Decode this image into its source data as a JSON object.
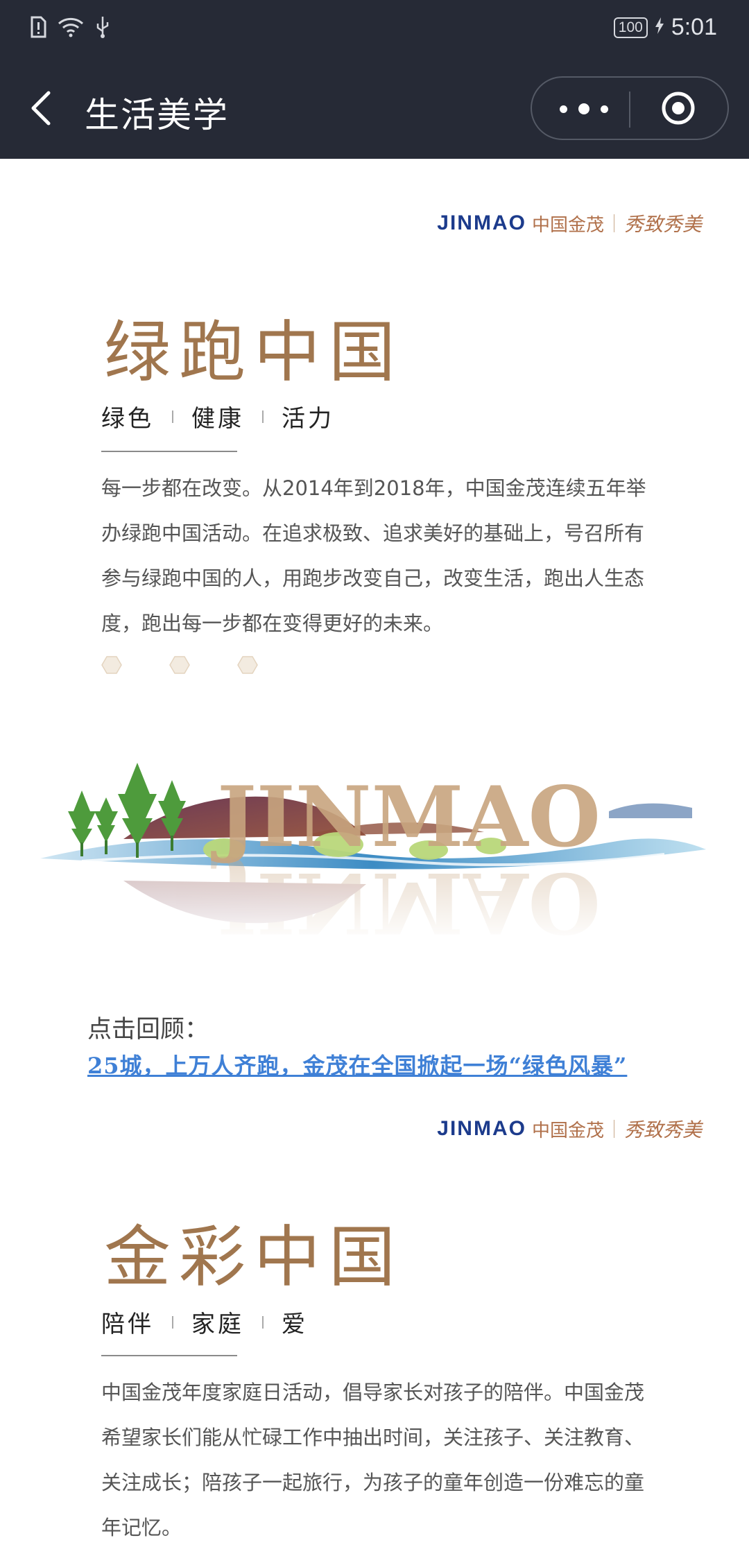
{
  "status_bar": {
    "battery": "100",
    "time": "5:01"
  },
  "nav": {
    "title": "生活美学"
  },
  "brand": {
    "logo_en": "JINMAO",
    "logo_cn": "中国金茂",
    "slogan": "秀致秀美"
  },
  "section1": {
    "title": "绿跑中国",
    "tags": [
      "绿色",
      "健康",
      "活力"
    ],
    "paragraph": "每一步都在改变。从2014年到2018年，中国金茂连续五年举办绿跑中国活动。在追求极致、追求美好的基础上，号召所有参与绿跑中国的人，用跑步改变自己，改变生活，跑出人生态度，跑出每一步都在变得更好的未来。",
    "banner_text": "JINMAO",
    "recap_label": "点击回顾：",
    "recap_link": "25城，上万人齐跑，金茂在全国掀起一场“绿色风暴”"
  },
  "section2": {
    "title": "金彩中国",
    "tags": [
      "陪伴",
      "家庭",
      "爱"
    ],
    "paragraph": "中国金茂年度家庭日活动，倡导家长对孩子的陪伴。中国金茂希望家长们能从忙碌工作中抽出时间，关注孩子、关注教育、关注成长；陪孩子一起旅行，为孩子的童年创造一份难忘的童年记忆。"
  },
  "colors": {
    "topbar": "#262a36",
    "title_gold": "#a0764e",
    "link_blue": "#3f80d6",
    "brand_blue": "#1c3b8c"
  }
}
